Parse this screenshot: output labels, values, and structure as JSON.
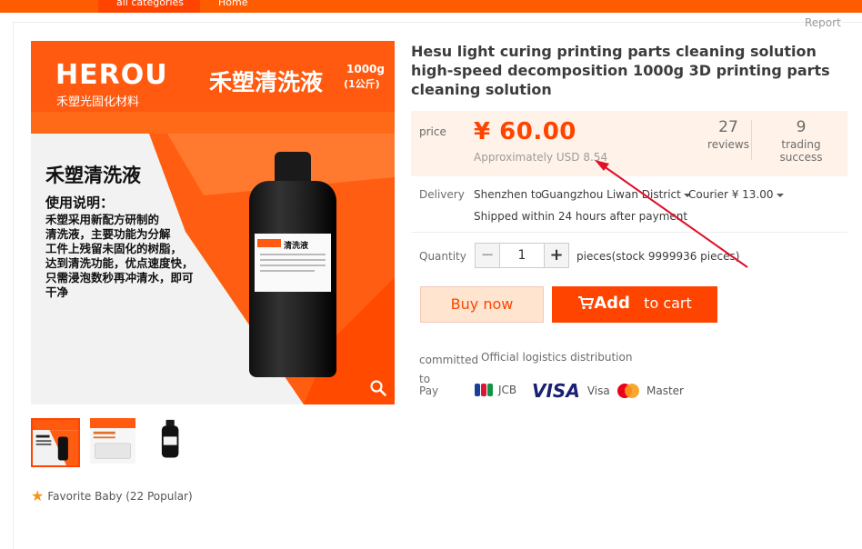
{
  "nav": {
    "categories": "all categories",
    "home": "Home"
  },
  "report": "Report",
  "product": {
    "title": "Hesu light curing printing parts cleaning solution high-speed decomposition 1000g 3D printing parts cleaning solution",
    "image": {
      "brand": "HEROU",
      "brand_sub": "禾塑光固化材料",
      "banner_title": "禾塑清洗液",
      "banner_weight": "1000g",
      "banner_weight_sub": "(1公斤)",
      "heading": "禾塑清洗液",
      "usage_title": "使用说明：",
      "usage_lines": [
        "禾塑采用新配方研制的",
        "清洗液，主要功能为分解",
        "工件上残留未固化的树脂，",
        "达到清洗功能，优点速度快，",
        "只需浸泡数秒再冲清水，即可",
        "干净"
      ],
      "bottle_label": "清洗液"
    },
    "favorite": "Favorite Baby (22 Popular)"
  },
  "price": {
    "label": "price",
    "value": "¥ 60.00",
    "usd": "Approximately USD 8.54",
    "reviews_count": "27",
    "reviews_label": "reviews",
    "trades_count": "9",
    "trades_label": "trading success"
  },
  "delivery": {
    "label": "Delivery",
    "from": "Shenzhen to",
    "to": "Guangzhou Liwan District",
    "method": "Courier ¥ 13.00",
    "shipping_note": "Shipped within 24 hours after payment"
  },
  "quantity": {
    "label": "Quantity",
    "minus": "−",
    "value": "1",
    "plus": "+",
    "stock": "pieces(stock 9999936 pieces)"
  },
  "buttons": {
    "buy_now": "Buy now",
    "add": "Add",
    "to_cart": "to cart"
  },
  "commitment": {
    "label": "committed to",
    "value": "Official logistics distribution",
    "pay_label": "Pay",
    "methods": [
      "JCB",
      "Visa",
      "Master"
    ],
    "visa_logo": "VISA"
  },
  "colors": {
    "accent": "#ff4400",
    "price_bg": "#fff2e8",
    "annotation": "#e0102a"
  }
}
